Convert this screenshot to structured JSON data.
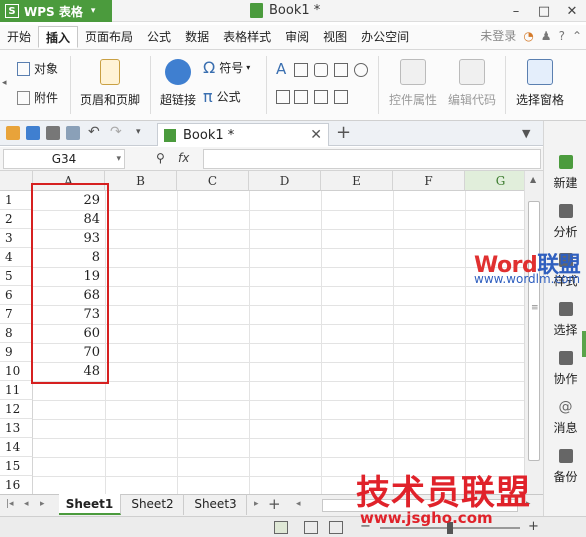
{
  "app": {
    "name": "WPS 表格",
    "logo": "S",
    "document_title": "Book1 *"
  },
  "menu": {
    "tabs": [
      "开始",
      "插入",
      "页面布局",
      "公式",
      "数据",
      "表格样式",
      "审阅",
      "视图",
      "办公空间"
    ],
    "active_tab": "插入",
    "login": "未登录"
  },
  "ribbon": {
    "object": "对象",
    "attachment": "附件",
    "header_footer": "页眉和页脚",
    "hyperlink": "超链接",
    "symbol": "符号",
    "formula": "公式",
    "control_properties": "控件属性",
    "edit_code": "编辑代码",
    "selection_pane": "选择窗格"
  },
  "doc_tab": {
    "label": "Book1 *"
  },
  "formula_bar": {
    "name_box": "G34",
    "fx": "fx",
    "value": ""
  },
  "grid": {
    "columns": [
      "A",
      "B",
      "C",
      "D",
      "E",
      "F",
      "G"
    ],
    "selected_column": "G",
    "rows": [
      "1",
      "2",
      "3",
      "4",
      "5",
      "6",
      "7",
      "8",
      "9",
      "10",
      "11",
      "12",
      "13",
      "14",
      "15",
      "16"
    ],
    "column_a_values": [
      "29",
      "84",
      "93",
      "8",
      "19",
      "68",
      "73",
      "60",
      "70",
      "48"
    ]
  },
  "side_panel": [
    "新建",
    "分析",
    "样式",
    "选择",
    "协作",
    "消息",
    "备份"
  ],
  "sheets": {
    "tabs": [
      "Sheet1",
      "Sheet2",
      "Sheet3"
    ],
    "active": "Sheet1"
  },
  "watermarks": {
    "word_part1": "Word",
    "word_part2": "联盟",
    "word_url": "www.wordlm.com",
    "big_text": "技术员联盟",
    "big_url": "www.jsgho.com"
  },
  "colors": {
    "accent": "#4b9b3d",
    "highlight": "#d62020",
    "watermark_red": "#e0222a",
    "watermark_blue": "#2f5fbf"
  }
}
